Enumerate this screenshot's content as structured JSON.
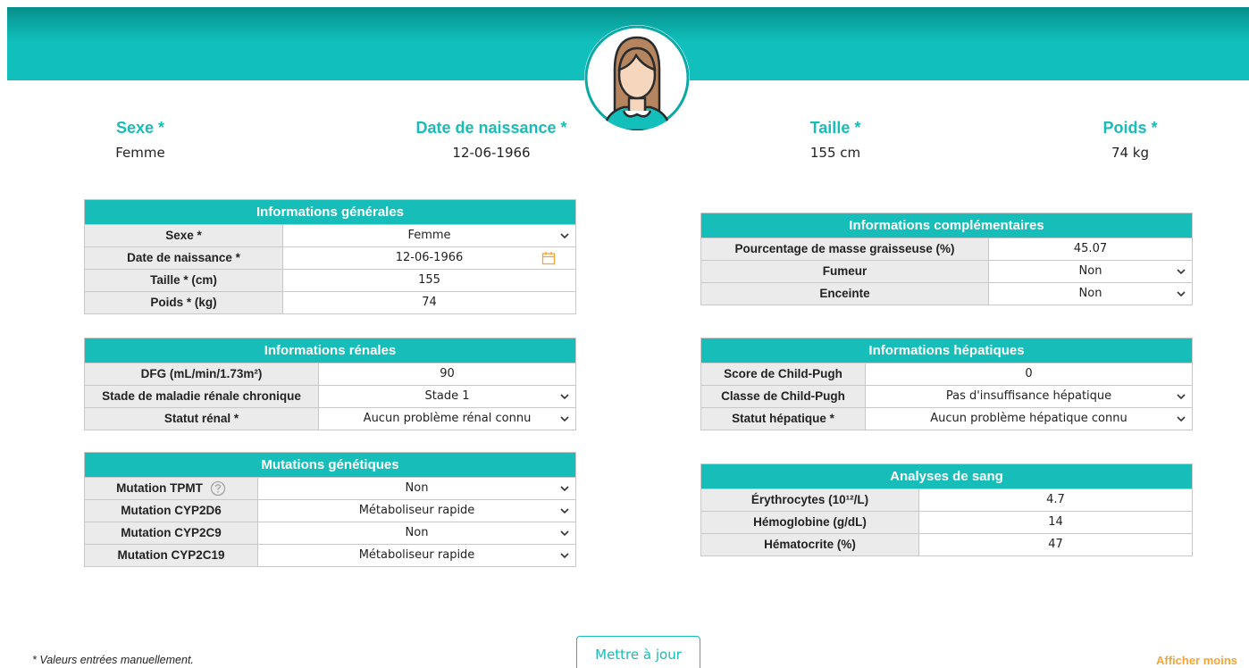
{
  "summary": [
    {
      "label": "Sexe *",
      "value": "Femme"
    },
    {
      "label": "Date de naissance *",
      "value": "12-06-1966"
    },
    {
      "label": "Taille *",
      "value": "155 cm"
    },
    {
      "label": "Poids *",
      "value": "74 kg"
    }
  ],
  "general": {
    "title": "Informations générales",
    "rows": [
      {
        "label": "Sexe *",
        "value": "Femme"
      },
      {
        "label": "Date de naissance *",
        "value": "12-06-1966"
      },
      {
        "label": "Taille * (cm)",
        "value": "155"
      },
      {
        "label": "Poids * (kg)",
        "value": "74"
      }
    ]
  },
  "renal": {
    "title": "Informations rénales",
    "rows": [
      {
        "label": "DFG (mL/min/1.73m²)",
        "value": "90"
      },
      {
        "label": "Stade de maladie rénale chronique",
        "value": "Stade 1"
      },
      {
        "label": "Statut rénal *",
        "value": "Aucun problème rénal connu"
      }
    ]
  },
  "genetic": {
    "title": "Mutations génétiques",
    "rows": [
      {
        "label": "Mutation TPMT",
        "value": "Non"
      },
      {
        "label": "Mutation CYP2D6",
        "value": "Métaboliseur rapide"
      },
      {
        "label": "Mutation CYP2C9",
        "value": "Non"
      },
      {
        "label": "Mutation CYP2C19",
        "value": "Métaboliseur rapide"
      }
    ]
  },
  "complementary": {
    "title": "Informations complémentaires",
    "rows": [
      {
        "label": "Pourcentage de masse graisseuse (%)",
        "value": "45.07"
      },
      {
        "label": "Fumeur",
        "value": "Non"
      },
      {
        "label": "Enceinte",
        "value": "Non"
      }
    ]
  },
  "hepatic": {
    "title": "Informations hépatiques",
    "rows": [
      {
        "label": "Score de Child-Pugh",
        "value": "0"
      },
      {
        "label": "Classe de Child-Pugh",
        "value": "Pas d'insuffisance hépatique"
      },
      {
        "label": "Statut hépatique *",
        "value": "Aucun problème hépatique connu"
      }
    ]
  },
  "blood": {
    "title": "Analyses de sang",
    "rows": [
      {
        "label": "Érythrocytes (10¹²/L)",
        "value": "4.7"
      },
      {
        "label": "Hémoglobine (g/dL)",
        "value": "14"
      },
      {
        "label": "Hématocrite (%)",
        "value": "47"
      }
    ]
  },
  "footer": {
    "note": "* Valeurs entrées manuellement.",
    "update_label": "Mettre à jour",
    "toggle_label": "Afficher moins"
  },
  "icons": {
    "avatar": "woman-avatar-icon",
    "dropdown": "chevron-down-icon",
    "calendar": "calendar-icon",
    "help": "question-circle-icon"
  },
  "colors": {
    "accent": "#17bdb8",
    "banner_dark": "#088e8a",
    "orange": "#f7a532",
    "label_bg": "#ebebeb"
  }
}
